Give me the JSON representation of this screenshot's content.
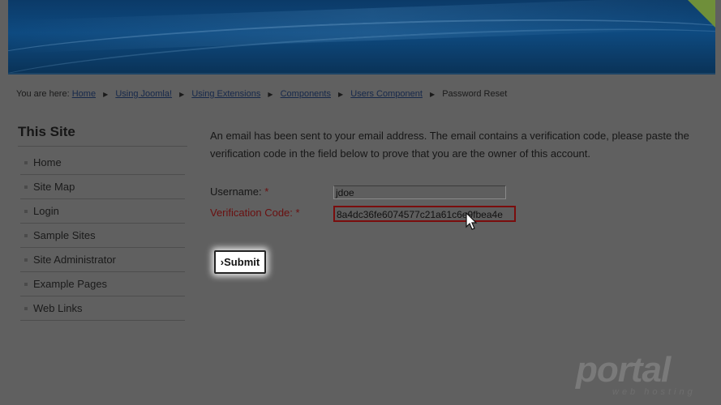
{
  "breadcrumb": {
    "prefix": "You are here:",
    "links": [
      "Home",
      "Using Joomla!",
      "Using Extensions",
      "Components",
      "Users Component"
    ],
    "current": "Password Reset"
  },
  "sidebar": {
    "title": "This Site",
    "items": [
      "Home",
      "Site Map",
      "Login",
      "Sample Sites",
      "Site Administrator",
      "Example Pages",
      "Web Links"
    ]
  },
  "main": {
    "intro": "An email has been sent to your email address. The email contains a verification code, please paste the verification code in the field below to prove that you are the owner of this account.",
    "username_label": "Username:",
    "username_value": "jdoe",
    "code_label": "Verification Code:",
    "code_value": "8a4dc36fe6074577c21a61c6e9fbea4e",
    "required_marker": "*",
    "submit_label": "Submit",
    "submit_prefix": "›"
  },
  "watermark": {
    "brand": "portal",
    "tagline": "web hosting"
  },
  "colors": {
    "overlay_bg": "#606060",
    "error_red": "#6a0f0f",
    "link_blue": "#16284a"
  }
}
